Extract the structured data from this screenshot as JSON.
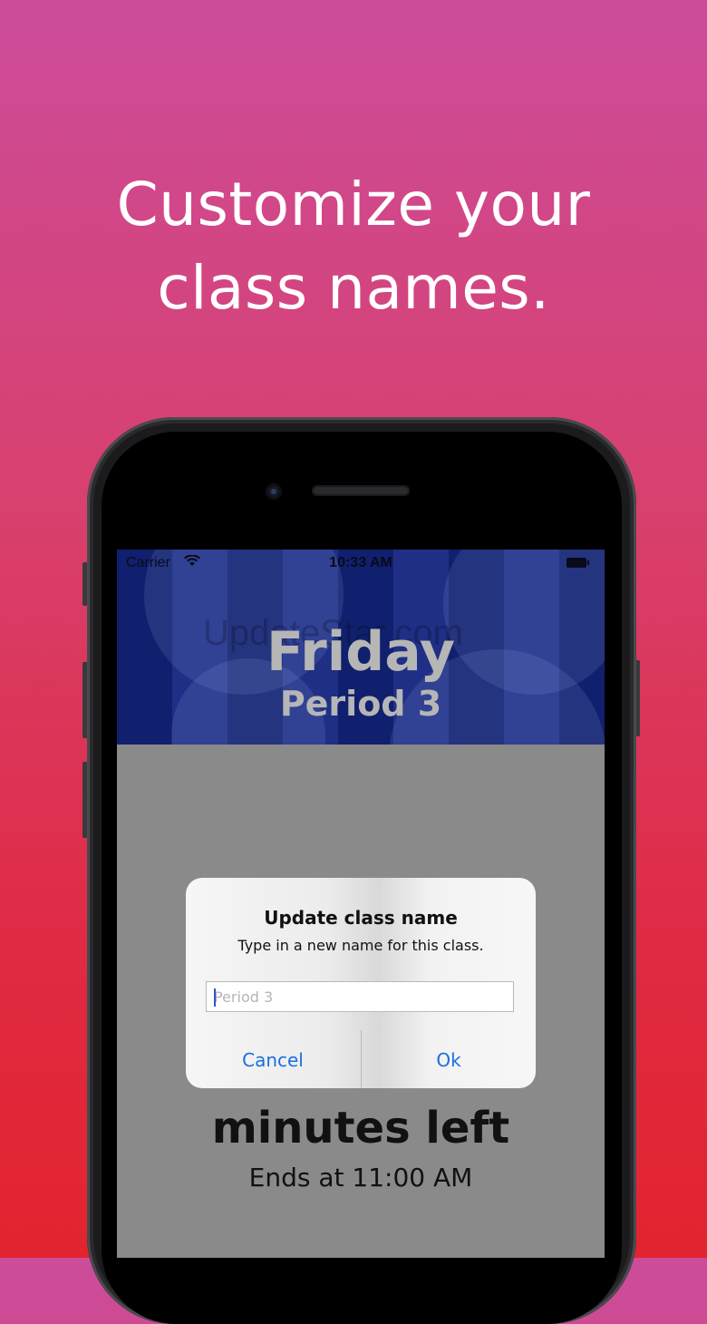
{
  "headline": [
    "Customize your",
    "class names."
  ],
  "status": {
    "carrier": "Carrier",
    "time": "10:33 AM"
  },
  "banner": {
    "day": "Friday",
    "period": "Period 3",
    "watermark": "UpdateStar.com"
  },
  "timer": {
    "minutes_label": "minutes left",
    "ends": "Ends at 11:00 AM"
  },
  "dialog": {
    "title": "Update class name",
    "message": "Type in a new name for this class.",
    "input_placeholder": "Period 3",
    "input_value": "",
    "cancel": "Cancel",
    "ok": "Ok"
  },
  "colors": {
    "accent": "#1a6fe0",
    "banner": "#10206e"
  },
  "icons": {
    "wifi": "wifi-icon",
    "battery": "battery-icon"
  }
}
